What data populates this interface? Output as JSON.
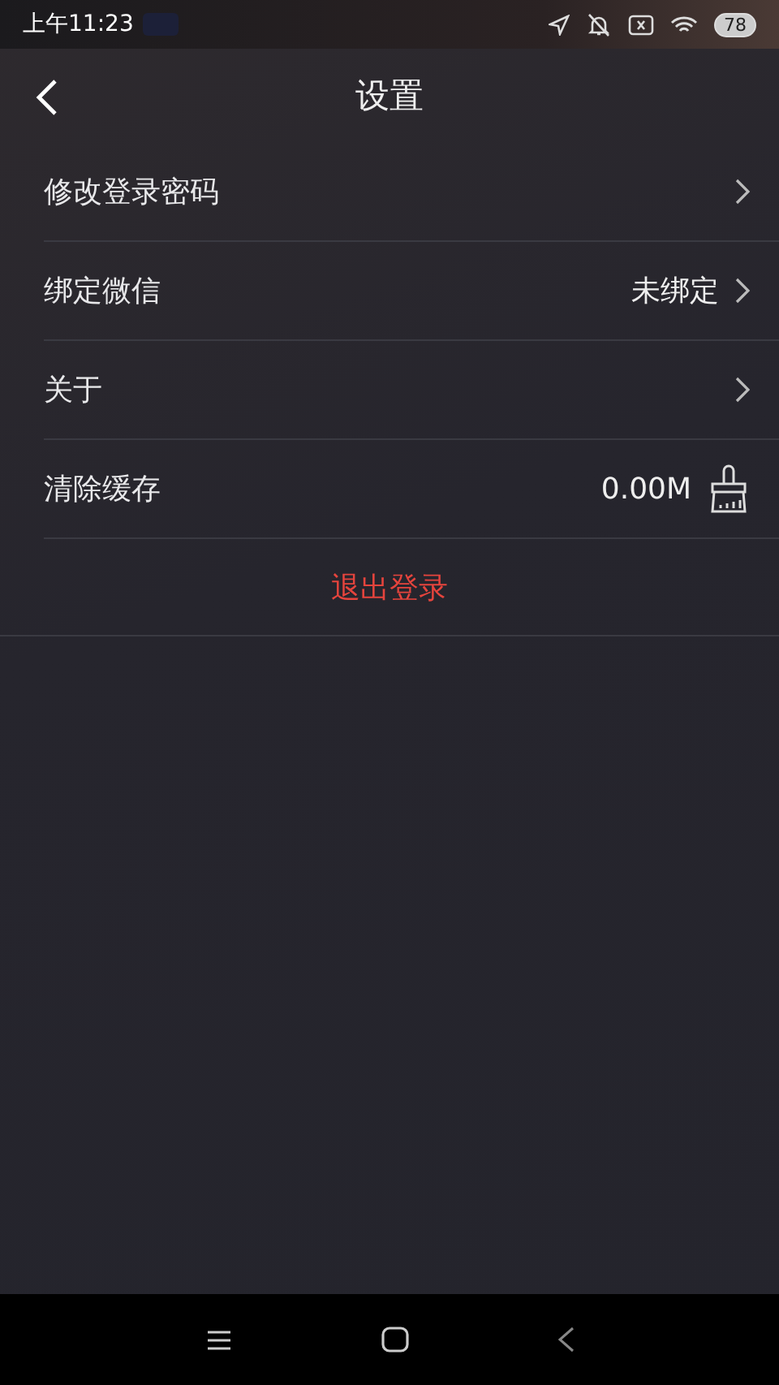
{
  "status_bar": {
    "time": "上午11:23",
    "battery": "78"
  },
  "header": {
    "title": "设置"
  },
  "rows": [
    {
      "kind": "link",
      "label": "修改登录密码"
    },
    {
      "kind": "link",
      "label": "绑定微信",
      "value": "未绑定"
    },
    {
      "kind": "link",
      "label": "关于"
    },
    {
      "kind": "cache",
      "label": "清除缓存",
      "value": "0.00M"
    }
  ],
  "logout": {
    "label": "退出登录"
  }
}
